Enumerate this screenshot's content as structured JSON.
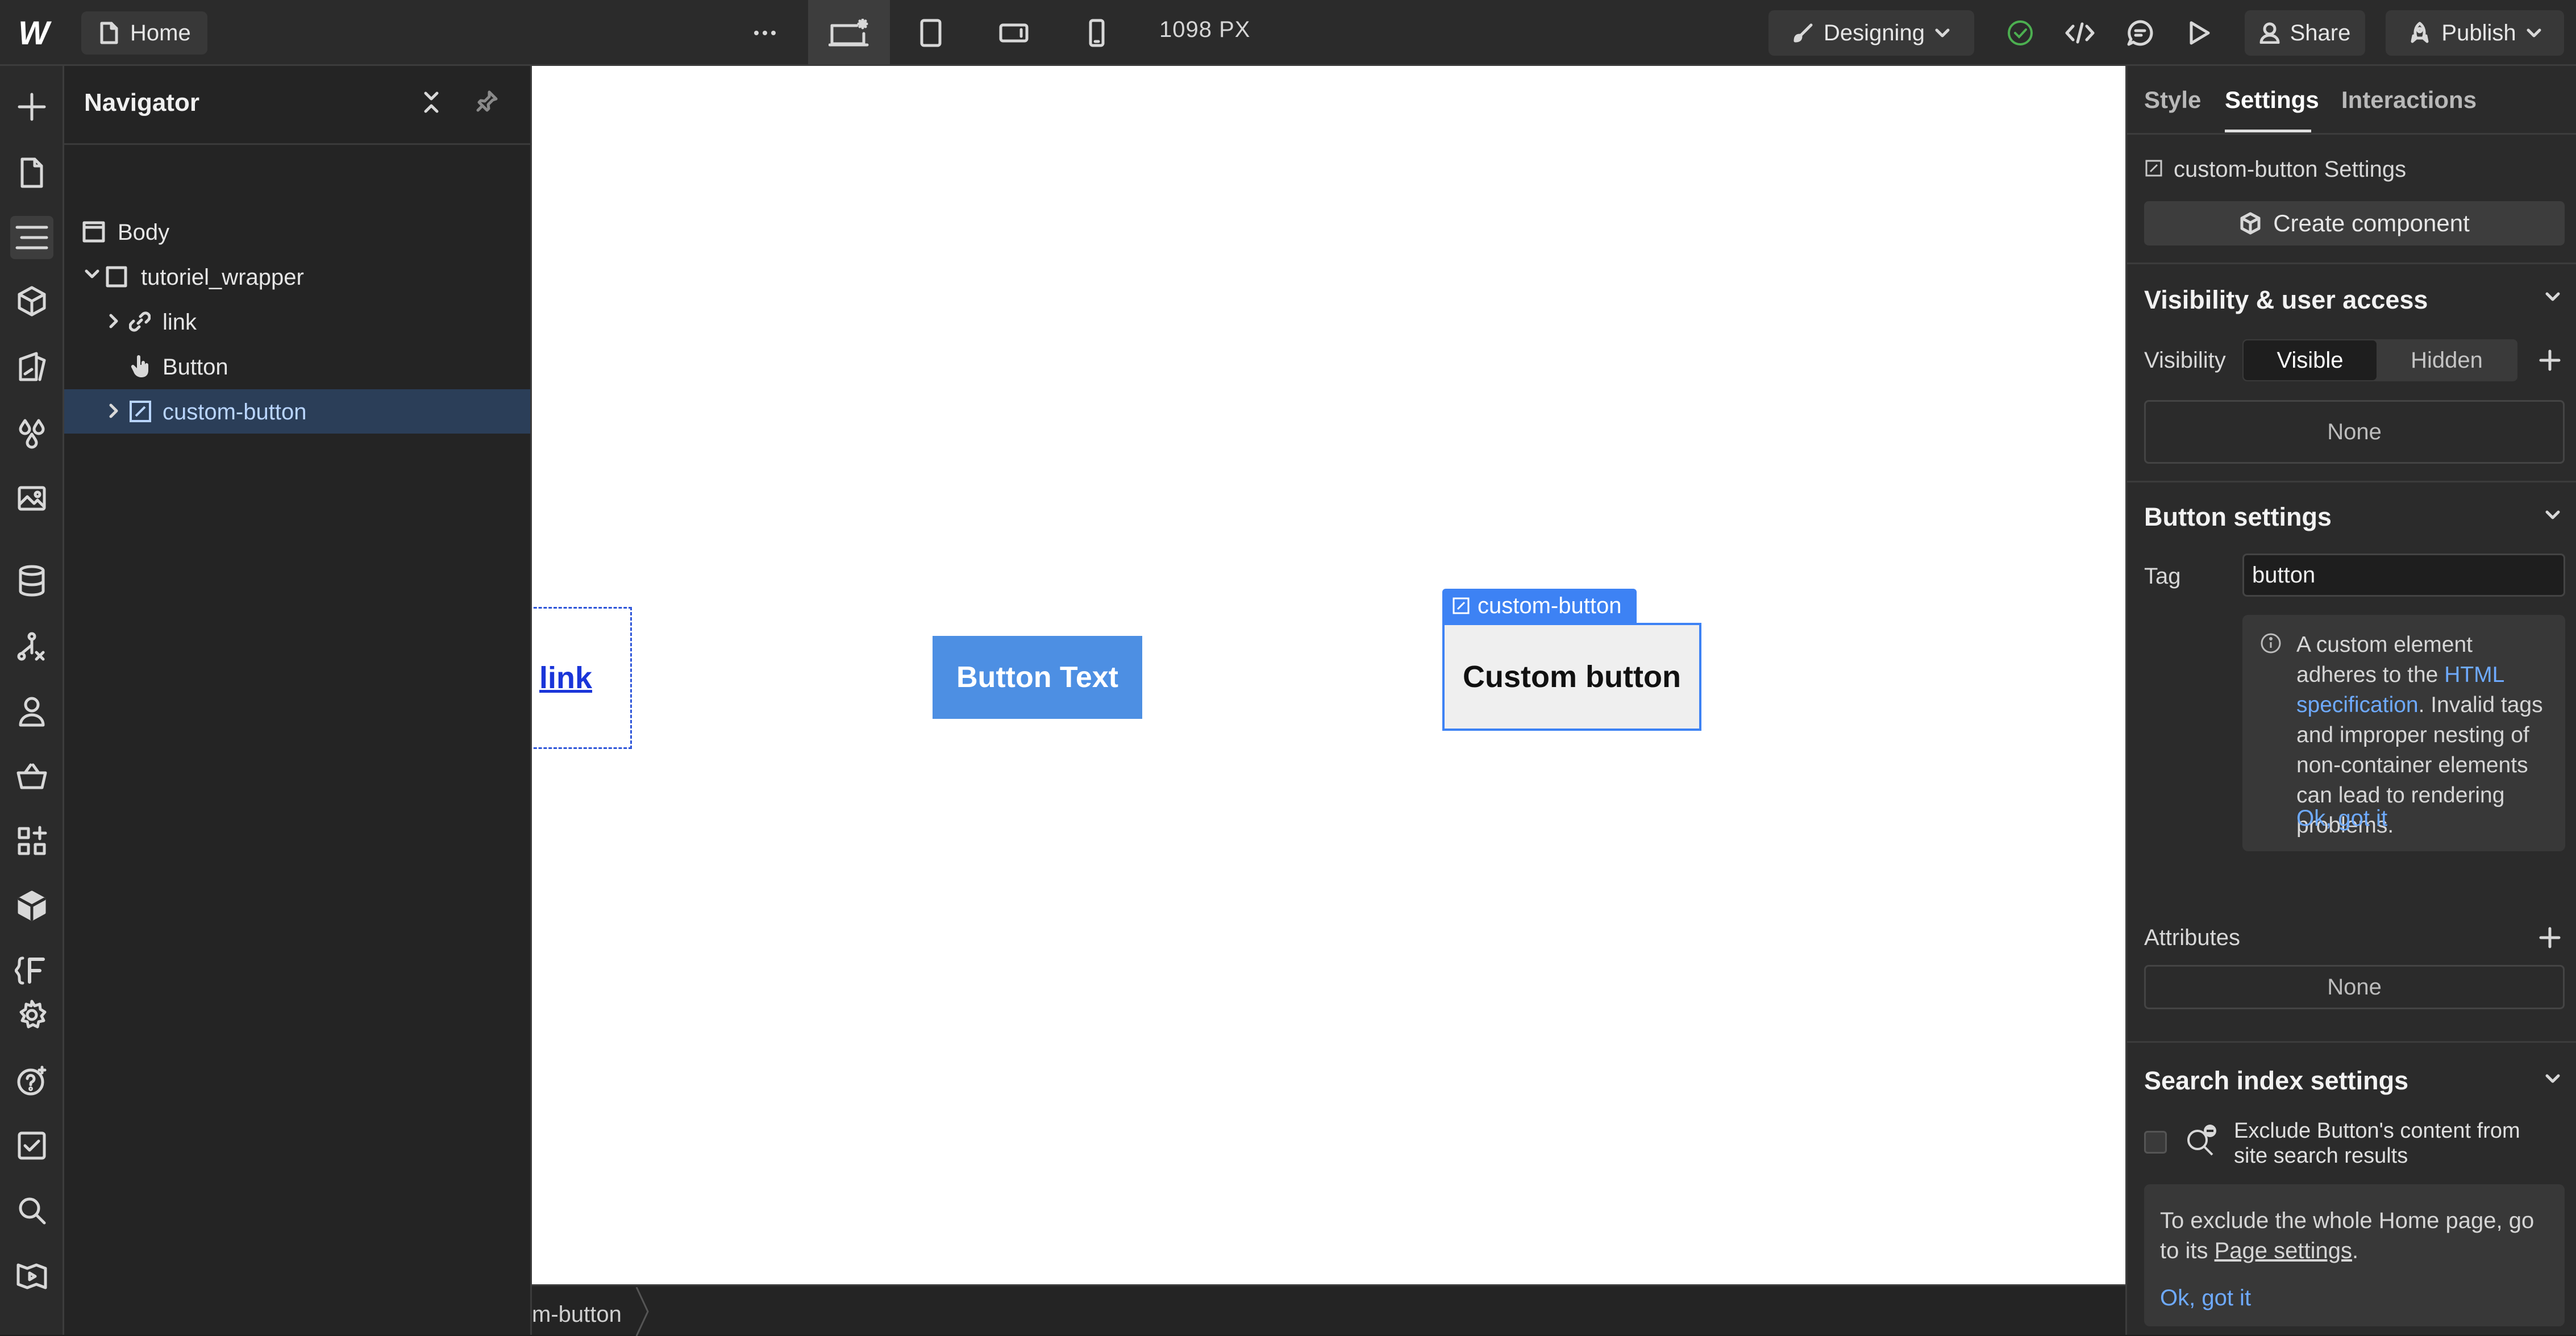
{
  "topbar": {
    "page_name": "Home",
    "canvas_width": "1098 PX",
    "mode_label": "Designing",
    "share_label": "Share",
    "publish_label": "Publish"
  },
  "navigator": {
    "title": "Navigator",
    "tree": [
      {
        "label": "Body",
        "icon": "body-icon"
      },
      {
        "label": "tutoriel_wrapper",
        "icon": "div-block-icon"
      },
      {
        "label": "link",
        "icon": "link-icon"
      },
      {
        "label": "Button",
        "icon": "hand-pointer-icon"
      },
      {
        "label": "custom-button",
        "icon": "custom-element-icon",
        "selected": true
      }
    ]
  },
  "canvas": {
    "link_text": "link",
    "button_text": "Button Text",
    "custom_tag_label": "custom-button",
    "custom_button_text": "Custom button"
  },
  "breadcrumb": {
    "text": "m-button"
  },
  "panel": {
    "tabs": [
      "Style",
      "Settings",
      "Interactions"
    ],
    "active_tab": "Settings",
    "element_settings_title": "custom-button Settings",
    "create_component": "Create component",
    "visibility": {
      "title": "Visibility & user access",
      "label": "Visibility",
      "visible": "Visible",
      "hidden": "Hidden",
      "none": "None"
    },
    "button_settings": {
      "title": "Button settings",
      "tag_label": "Tag",
      "tag_value": "button",
      "info_part1": "A custom element adheres to the ",
      "info_link": "HTML specification",
      "info_part2": ". Invalid tags and improper nesting of non-container elements can lead to rendering problems.",
      "ok": "Ok, got it"
    },
    "attributes": {
      "label": "Attributes",
      "none": "None"
    },
    "search_index": {
      "title": "Search index settings",
      "checkbox_label": "Exclude Button's content from site search results",
      "note_part1": "To exclude the whole Home page, go to its ",
      "note_link": "Page settings",
      "note_part2": ".",
      "ok": "Ok, got it"
    }
  },
  "colors": {
    "accent": "#3d82f4",
    "selected_row": "#2b3e58",
    "status_ok": "#4caf50",
    "canvas_button": "#4d8fe3"
  }
}
